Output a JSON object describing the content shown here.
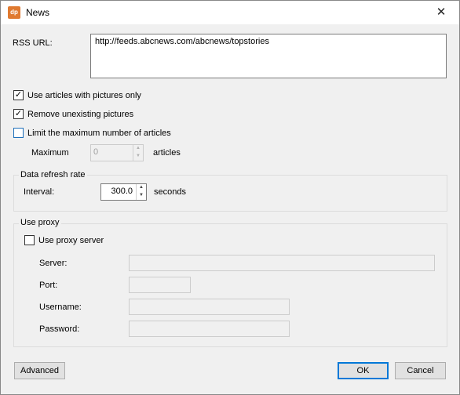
{
  "window": {
    "title": "News",
    "icon_text": "dp",
    "close_glyph": "✕"
  },
  "rss": {
    "label": "RSS URL:",
    "value": "http://feeds.abcnews.com/abcnews/topstories"
  },
  "options": {
    "pictures_only": {
      "label": "Use articles with pictures only",
      "checked": true
    },
    "remove_unexisting": {
      "label": "Remove unexisting pictures",
      "checked": true
    },
    "limit_max": {
      "label": "Limit the maximum number of articles",
      "checked": false
    }
  },
  "maximum": {
    "label": "Maximum",
    "value": "0",
    "unit": "articles"
  },
  "refresh": {
    "group_title": "Data refresh rate",
    "label": "Interval:",
    "value": "300.0",
    "unit": "seconds"
  },
  "proxy": {
    "group_title": "Use proxy",
    "use_proxy": {
      "label": "Use proxy server",
      "checked": false
    },
    "server_label": "Server:",
    "port_label": "Port:",
    "username_label": "Username:",
    "password_label": "Password:",
    "server_value": "",
    "port_value": "",
    "username_value": "",
    "password_value": ""
  },
  "buttons": {
    "advanced": "Advanced",
    "ok": "OK",
    "cancel": "Cancel"
  },
  "glyphs": {
    "check": "✓",
    "up": "▲",
    "down": "▼"
  },
  "colors": {
    "accent": "#0078d7",
    "icon_bg": "#e07a30"
  }
}
